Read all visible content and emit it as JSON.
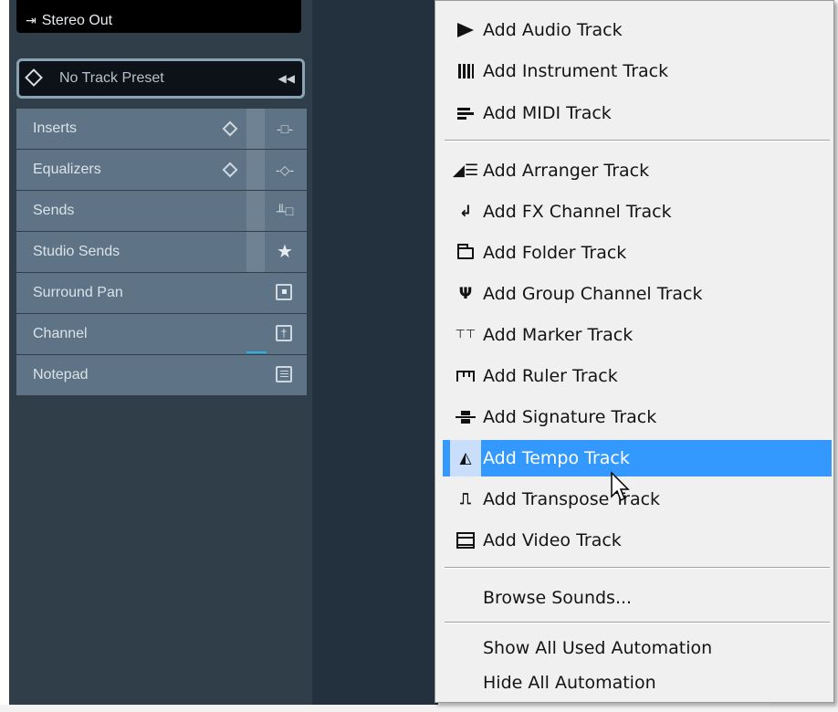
{
  "inspector": {
    "output_routing": "Stereo Out",
    "track_preset": "No Track Preset",
    "sections": [
      {
        "label": "Inserts"
      },
      {
        "label": "Equalizers"
      },
      {
        "label": "Sends"
      },
      {
        "label": "Studio Sends"
      },
      {
        "label": "Surround Pan"
      },
      {
        "label": "Channel"
      },
      {
        "label": "Notepad"
      }
    ]
  },
  "context_menu": {
    "items": [
      {
        "label": "Add Audio Track",
        "icon": "play-icon"
      },
      {
        "label": "Add Instrument Track",
        "icon": "keyboard-icon"
      },
      {
        "label": "Add MIDI Track",
        "icon": "midi-icon"
      },
      {
        "label": "Add Arranger Track",
        "icon": "arranger-icon"
      },
      {
        "label": "Add FX Channel Track",
        "icon": "fx-return-icon"
      },
      {
        "label": "Add Folder Track",
        "icon": "folder-icon"
      },
      {
        "label": "Add Group Channel Track",
        "icon": "group-icon"
      },
      {
        "label": "Add Marker Track",
        "icon": "marker-icon"
      },
      {
        "label": "Add Ruler Track",
        "icon": "ruler-icon"
      },
      {
        "label": "Add Signature Track",
        "icon": "signature-icon"
      },
      {
        "label": "Add Tempo Track",
        "icon": "metronome-icon",
        "highlighted": true
      },
      {
        "label": "Add Transpose Track",
        "icon": "transpose-icon"
      },
      {
        "label": "Add Video Track",
        "icon": "film-icon"
      }
    ],
    "browse_sounds": "Browse Sounds...",
    "show_all_used_automation": "Show All Used Automation",
    "hide_all_automation": "Hide All Automation"
  },
  "colors": {
    "menu_highlight": "#3399ff",
    "inspector_bg": "#303e4a",
    "section_bg": "#5e7385",
    "accent_cyan": "#21b6e8"
  }
}
